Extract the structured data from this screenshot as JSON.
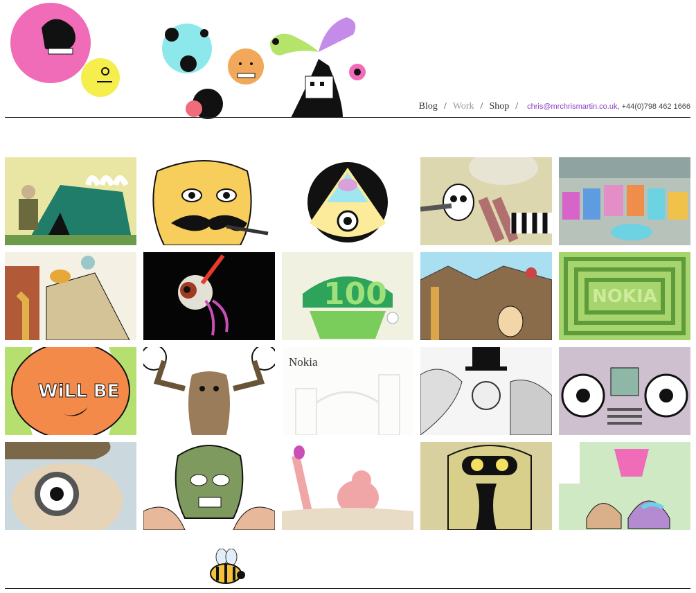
{
  "nav": {
    "blog": "Blog",
    "work": "Work",
    "shop": "Shop",
    "sep": "/",
    "email": "chris@mrchrismartin.co.uk",
    "phone": ", +44(0)798 462 1666"
  },
  "tiles": [
    {
      "icon": "tent-illustration-icon"
    },
    {
      "icon": "moustache-man-icon"
    },
    {
      "icon": "eye-triangle-icon"
    },
    {
      "icon": "chainsaw-creature-icon"
    },
    {
      "icon": "comcast-letters-icon"
    },
    {
      "icon": "giraffe-construction-icon"
    },
    {
      "icon": "eyeball-icon"
    },
    {
      "icon": "cupcake-100-icon"
    },
    {
      "icon": "giraffe-desert-icon"
    },
    {
      "icon": "nokia-maze-icon"
    },
    {
      "icon": "basketball-will-be-icon"
    },
    {
      "icon": "moose-icon"
    },
    {
      "label": "Nokia",
      "icon": "nokia-sketch-icon"
    },
    {
      "icon": "top-hat-crowd-icon"
    },
    {
      "icon": "machine-eyes-icon"
    },
    {
      "icon": "hat-eye-character-icon"
    },
    {
      "icon": "balaclava-man-icon"
    },
    {
      "icon": "bath-man-icon"
    },
    {
      "icon": "yellow-face-icon"
    },
    {
      "icon": "huts-icon"
    }
  ],
  "colors": {
    "accent": "#8a3fc7",
    "muted": "#999999",
    "rule": "#222222"
  }
}
